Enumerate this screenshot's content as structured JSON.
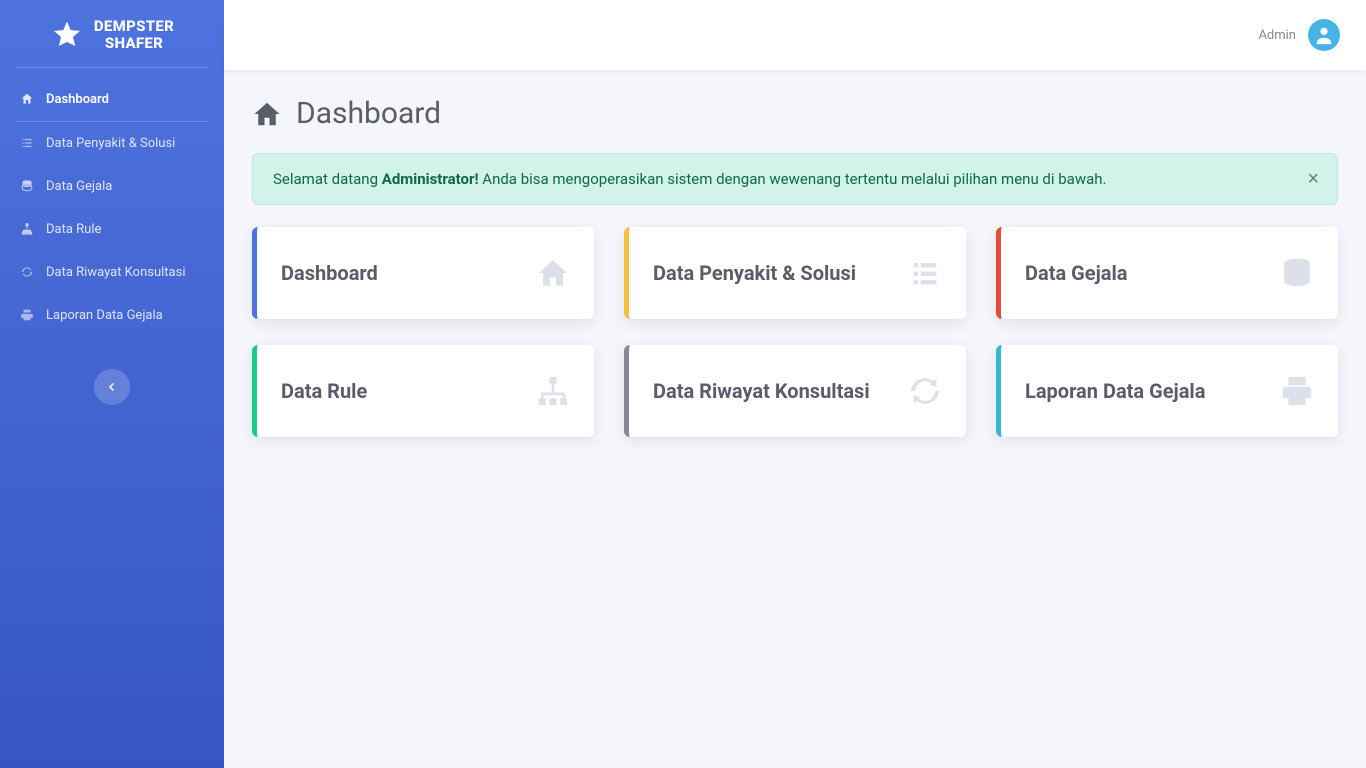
{
  "brand": {
    "line1": "DEMPSTER",
    "line2": "SHAFER"
  },
  "header": {
    "user_label": "Admin"
  },
  "page": {
    "title": "Dashboard"
  },
  "alert": {
    "greeting": "Selamat datang ",
    "strong": "Administrator!",
    "rest": " Anda bisa mengoperasikan sistem dengan wewenang tertentu melalui pilihan menu di bawah."
  },
  "sidebar": {
    "items": [
      {
        "label": "Dashboard"
      },
      {
        "label": "Data Penyakit & Solusi"
      },
      {
        "label": "Data Gejala"
      },
      {
        "label": "Data Rule"
      },
      {
        "label": "Data Riwayat Konsultasi"
      },
      {
        "label": "Laporan Data Gejala"
      }
    ]
  },
  "cards": [
    {
      "title": "Dashboard"
    },
    {
      "title": "Data Penyakit & Solusi"
    },
    {
      "title": "Data Gejala"
    },
    {
      "title": "Data Rule"
    },
    {
      "title": "Data Riwayat Konsultasi"
    },
    {
      "title": "Laporan Data Gejala"
    }
  ]
}
